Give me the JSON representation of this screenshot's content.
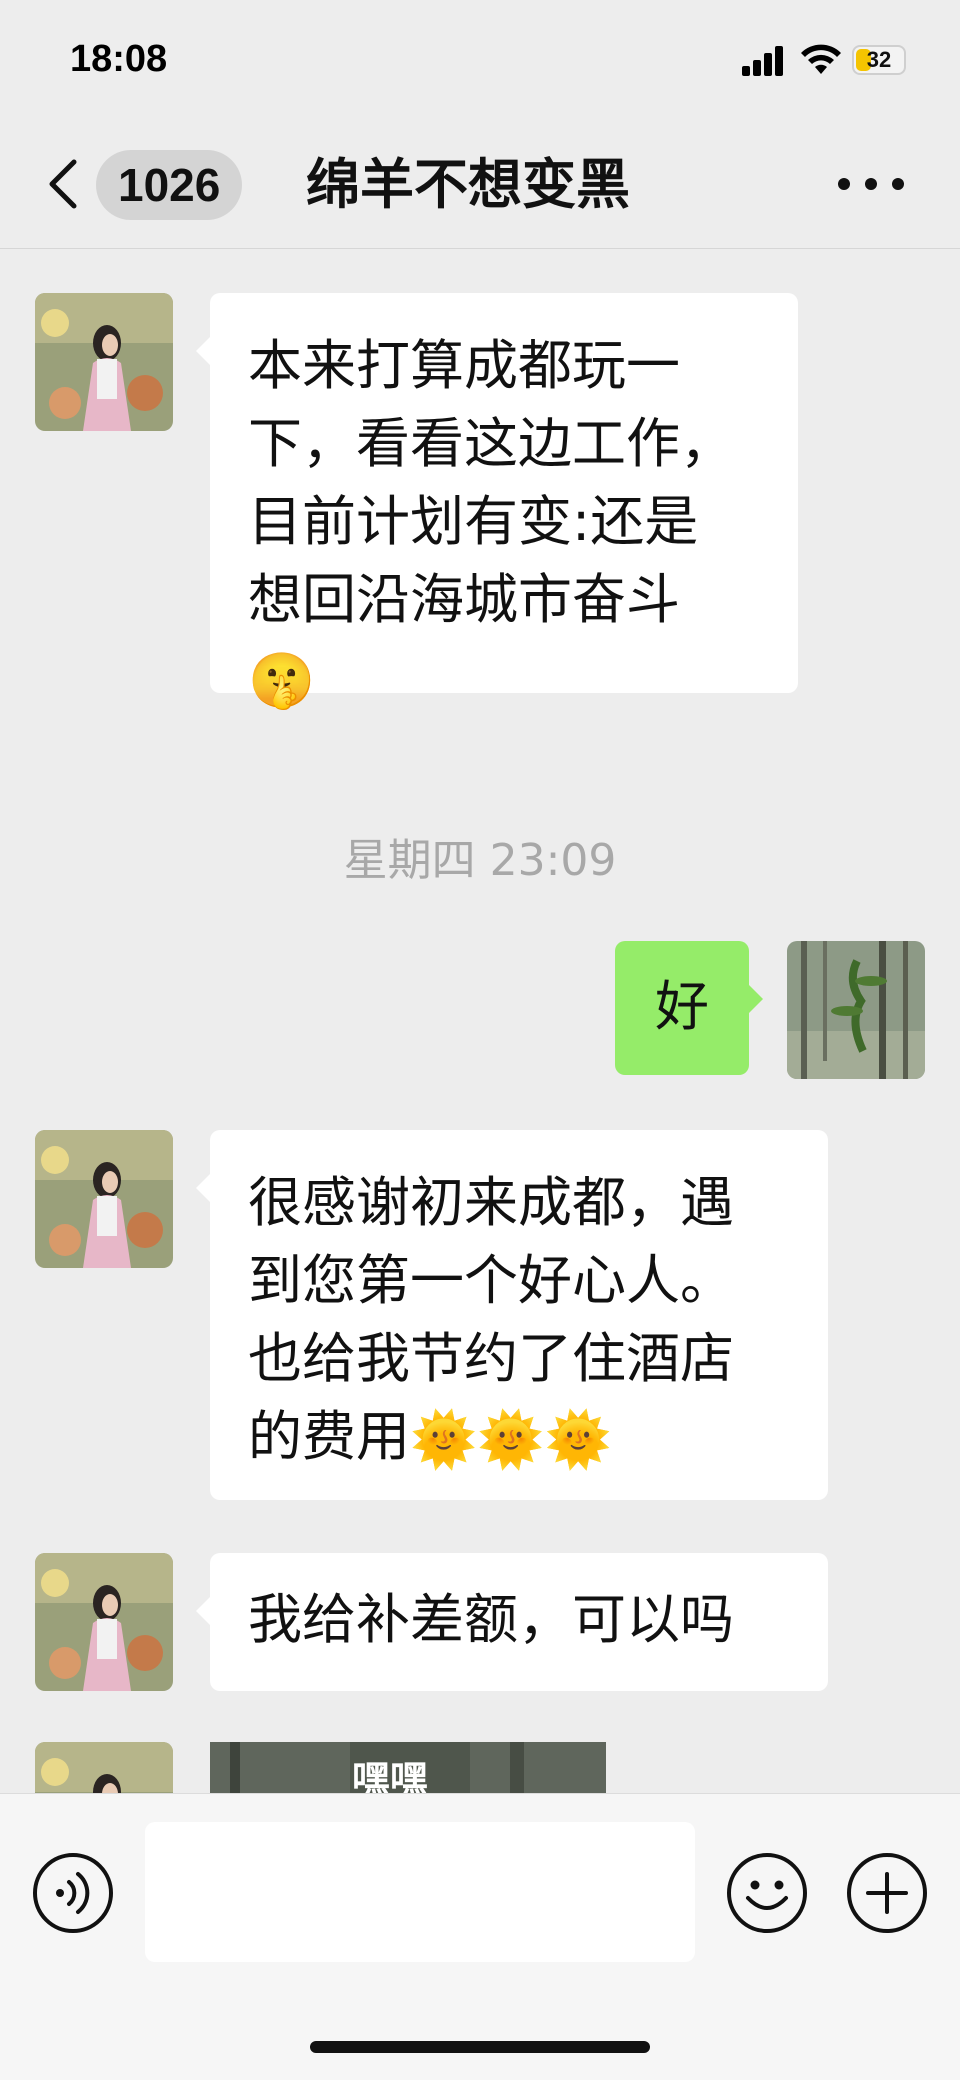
{
  "status_bar": {
    "time": "18:08",
    "battery": "32",
    "battery_level": 0.32
  },
  "header": {
    "unread_count": "1026",
    "title": "绵羊不想变黑"
  },
  "messages": [
    {
      "side": "left",
      "lines": [
        "本来打算成都玩一",
        "下，看看这边工作，",
        "目前计划有变:还是",
        "想回沿海城市奋斗"
      ],
      "emoji": "🤫"
    },
    {
      "timestamp": "星期四 23:09"
    },
    {
      "side": "right",
      "text": "好"
    },
    {
      "side": "left",
      "lines": [
        "很感谢初来成都，遇",
        "到您第一个好心人。",
        "也给我节约了住酒店"
      ],
      "last_line": "的费用",
      "emoji": "🌞🌞🌞"
    },
    {
      "side": "left",
      "text": "我给补差额，可以吗"
    },
    {
      "side": "left",
      "type": "video",
      "thumb_text": "嘿嘿"
    }
  ],
  "input": {
    "placeholder": ""
  },
  "icons": {
    "back": "chevron-left-icon",
    "more": "more-dots-icon",
    "voice": "voice-icon",
    "emoji": "emoji-icon",
    "plus": "plus-icon"
  },
  "colors": {
    "accent_bubble": "#95ec69",
    "background": "#ededed"
  }
}
